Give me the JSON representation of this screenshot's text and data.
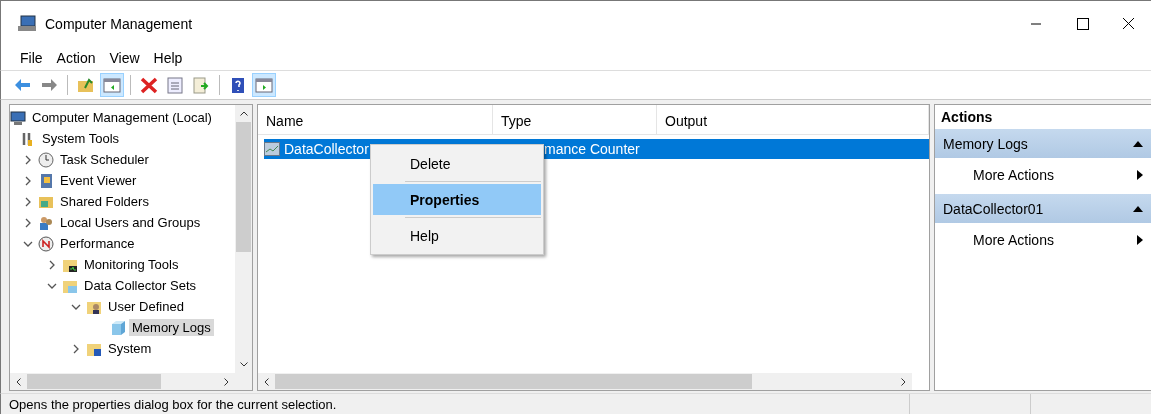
{
  "window": {
    "title": "Computer Management"
  },
  "menu_bar": [
    "File",
    "Action",
    "View",
    "Help"
  ],
  "toolbar": [
    {
      "pressed": false
    },
    {
      "pressed": false
    },
    {
      "pressed": false
    },
    {
      "pressed": true
    },
    {
      "pressed": false
    },
    {
      "pressed": false
    },
    {
      "pressed": false
    },
    {
      "pressed": false
    },
    {
      "pressed": true
    }
  ],
  "tree": [
    {
      "label": "Computer Management (Local)",
      "selected": false,
      "children": [
        {
          "label": "System Tools",
          "selected": false,
          "children": [
            {
              "label": "Task Scheduler",
              "selected": false,
              "expanded": false
            },
            {
              "label": "Event Viewer",
              "selected": false,
              "expanded": false
            },
            {
              "label": "Shared Folders",
              "selected": false,
              "expanded": false
            },
            {
              "label": "Local Users and Groups",
              "selected": false,
              "expanded": false
            },
            {
              "label": "Performance",
              "selected": false,
              "expanded": true,
              "children": [
                {
                  "label": "Monitoring Tools",
                  "selected": false,
                  "expanded": false
                },
                {
                  "label": "Data Collector Sets",
                  "selected": false,
                  "expanded": true,
                  "children": [
                    {
                      "label": "User Defined",
                      "selected": false,
                      "expanded": true,
                      "children": [
                        {
                          "label": "Memory Logs",
                          "selected": true
                        }
                      ]
                    },
                    {
                      "label": "System",
                      "selected": false,
                      "expanded": false
                    }
                  ]
                }
              ]
            }
          ]
        }
      ]
    }
  ],
  "table": {
    "columns": [
      "Name",
      "Type",
      "Output"
    ],
    "rows": [
      {
        "selected": true,
        "cells": [
          "DataCollector",
          "mance Counter",
          ""
        ]
      }
    ]
  },
  "context_menu": [
    {
      "label": "Delete",
      "selected": false
    },
    {
      "label": "Properties",
      "selected": true,
      "bold": true
    },
    {
      "label": "Help",
      "selected": false
    }
  ],
  "actions": {
    "title": "Actions",
    "sections": [
      {
        "title": "Memory Logs",
        "items": [
          "More Actions"
        ]
      },
      {
        "title": "DataCollector01",
        "items": [
          "More Actions"
        ]
      }
    ]
  },
  "status_bar": "Opens the properties dialog box for the current selection."
}
